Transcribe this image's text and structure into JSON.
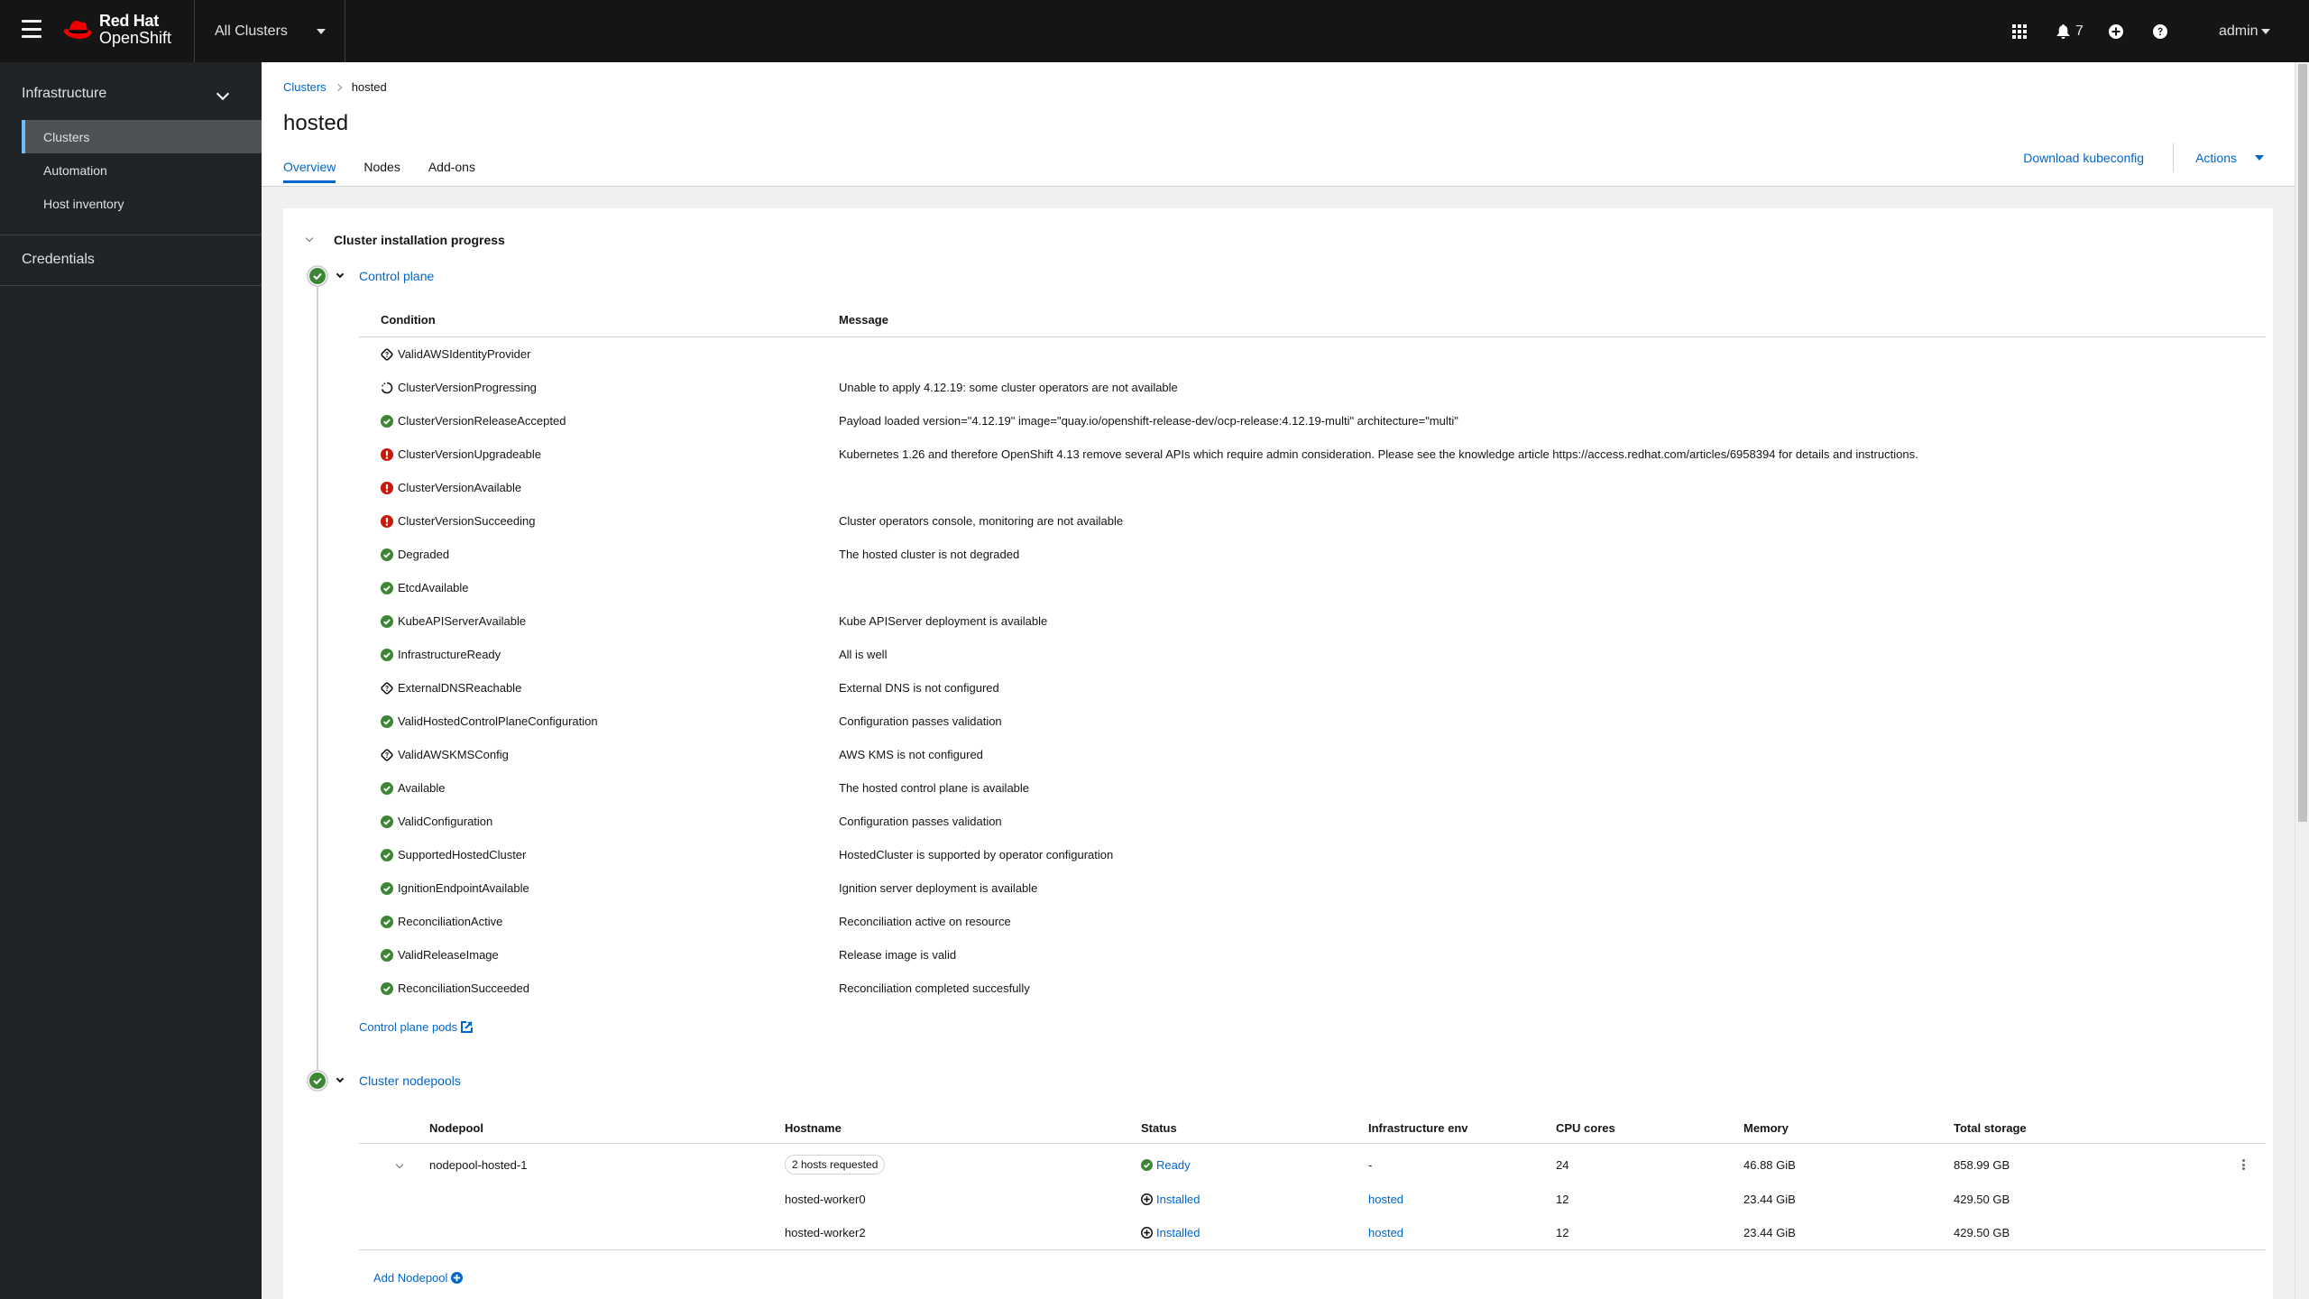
{
  "masthead": {
    "brand_line1": "Red Hat",
    "brand_line2": "OpenShift",
    "cluster_switcher": "All Clusters",
    "notifications_count": "7",
    "user": "admin",
    "icons": [
      "menu-icon",
      "app-launcher-icon",
      "bell-icon",
      "plus-circle-icon",
      "help-icon"
    ]
  },
  "sidebar": {
    "group": "Infrastructure",
    "items": [
      {
        "label": "Clusters",
        "active": true
      },
      {
        "label": "Automation",
        "active": false
      },
      {
        "label": "Host inventory",
        "active": false
      }
    ],
    "credentials": "Credentials"
  },
  "page": {
    "breadcrumb": {
      "parent": "Clusters",
      "current": "hosted"
    },
    "title": "hosted",
    "tabs": [
      {
        "label": "Overview",
        "active": true
      },
      {
        "label": "Nodes",
        "active": false
      },
      {
        "label": "Add-ons",
        "active": false
      }
    ],
    "download_kubeconfig": "Download kubeconfig",
    "actions": "Actions"
  },
  "progress": {
    "title": "Cluster installation progress",
    "control_plane": {
      "label": "Control plane",
      "columns": [
        "Condition",
        "Message"
      ],
      "conditions": [
        {
          "name": "ValidAWSIdentityProvider",
          "status": "unknown",
          "message": ""
        },
        {
          "name": "ClusterVersionProgressing",
          "status": "progress",
          "message": "Unable to apply 4.12.19: some cluster operators are not available"
        },
        {
          "name": "ClusterVersionReleaseAccepted",
          "status": "ok",
          "message": "Payload loaded version=\"4.12.19\" image=\"quay.io/openshift-release-dev/ocp-release:4.12.19-multi\" architecture=\"multi\""
        },
        {
          "name": "ClusterVersionUpgradeable",
          "status": "error",
          "message": "Kubernetes 1.26 and therefore OpenShift 4.13 remove several APIs which require admin consideration. Please see the knowledge article https://access.redhat.com/articles/6958394 for details and instructions."
        },
        {
          "name": "ClusterVersionAvailable",
          "status": "error",
          "message": ""
        },
        {
          "name": "ClusterVersionSucceeding",
          "status": "error",
          "message": "Cluster operators console, monitoring are not available"
        },
        {
          "name": "Degraded",
          "status": "ok",
          "message": "The hosted cluster is not degraded"
        },
        {
          "name": "EtcdAvailable",
          "status": "ok",
          "message": ""
        },
        {
          "name": "KubeAPIServerAvailable",
          "status": "ok",
          "message": "Kube APIServer deployment is available"
        },
        {
          "name": "InfrastructureReady",
          "status": "ok",
          "message": "All is well"
        },
        {
          "name": "ExternalDNSReachable",
          "status": "unknown",
          "message": "External DNS is not configured"
        },
        {
          "name": "ValidHostedControlPlaneConfiguration",
          "status": "ok",
          "message": "Configuration passes validation"
        },
        {
          "name": "ValidAWSKMSConfig",
          "status": "unknown",
          "message": "AWS KMS is not configured"
        },
        {
          "name": "Available",
          "status": "ok",
          "message": "The hosted control plane is available"
        },
        {
          "name": "ValidConfiguration",
          "status": "ok",
          "message": "Configuration passes validation"
        },
        {
          "name": "SupportedHostedCluster",
          "status": "ok",
          "message": "HostedCluster is supported by operator configuration"
        },
        {
          "name": "IgnitionEndpointAvailable",
          "status": "ok",
          "message": "Ignition server deployment is available"
        },
        {
          "name": "ReconciliationActive",
          "status": "ok",
          "message": "Reconciliation active on resource"
        },
        {
          "name": "ValidReleaseImage",
          "status": "ok",
          "message": "Release image is valid"
        },
        {
          "name": "ReconciliationSucceeded",
          "status": "ok",
          "message": "Reconciliation completed succesfully"
        }
      ],
      "pods_link": "Control plane pods"
    },
    "nodepools": {
      "label": "Cluster nodepools",
      "columns": [
        "Nodepool",
        "Hostname",
        "Status",
        "Infrastructure env",
        "CPU cores",
        "Memory",
        "Total storage"
      ],
      "pool": {
        "name": "nodepool-hosted-1",
        "hosts_badge": "2 hosts requested",
        "status": "Ready",
        "infra_env": "-",
        "cpu": "24",
        "memory": "46.88 GiB",
        "storage": "858.99 GB"
      },
      "hosts": [
        {
          "hostname": "hosted-worker0",
          "status": "Installed",
          "infra_env": "hosted",
          "cpu": "12",
          "memory": "23.44 GiB",
          "storage": "429.50 GB"
        },
        {
          "hostname": "hosted-worker2",
          "status": "Installed",
          "infra_env": "hosted",
          "cpu": "12",
          "memory": "23.44 GiB",
          "storage": "429.50 GB"
        }
      ],
      "add_label": "Add Nodepool"
    }
  },
  "colors": {
    "masthead_bg": "#151515",
    "sidebar_bg": "#212427",
    "link": "#0066cc",
    "success": "#3e8635",
    "danger": "#c9190b",
    "active_nav_marker": "#73bcf7"
  }
}
